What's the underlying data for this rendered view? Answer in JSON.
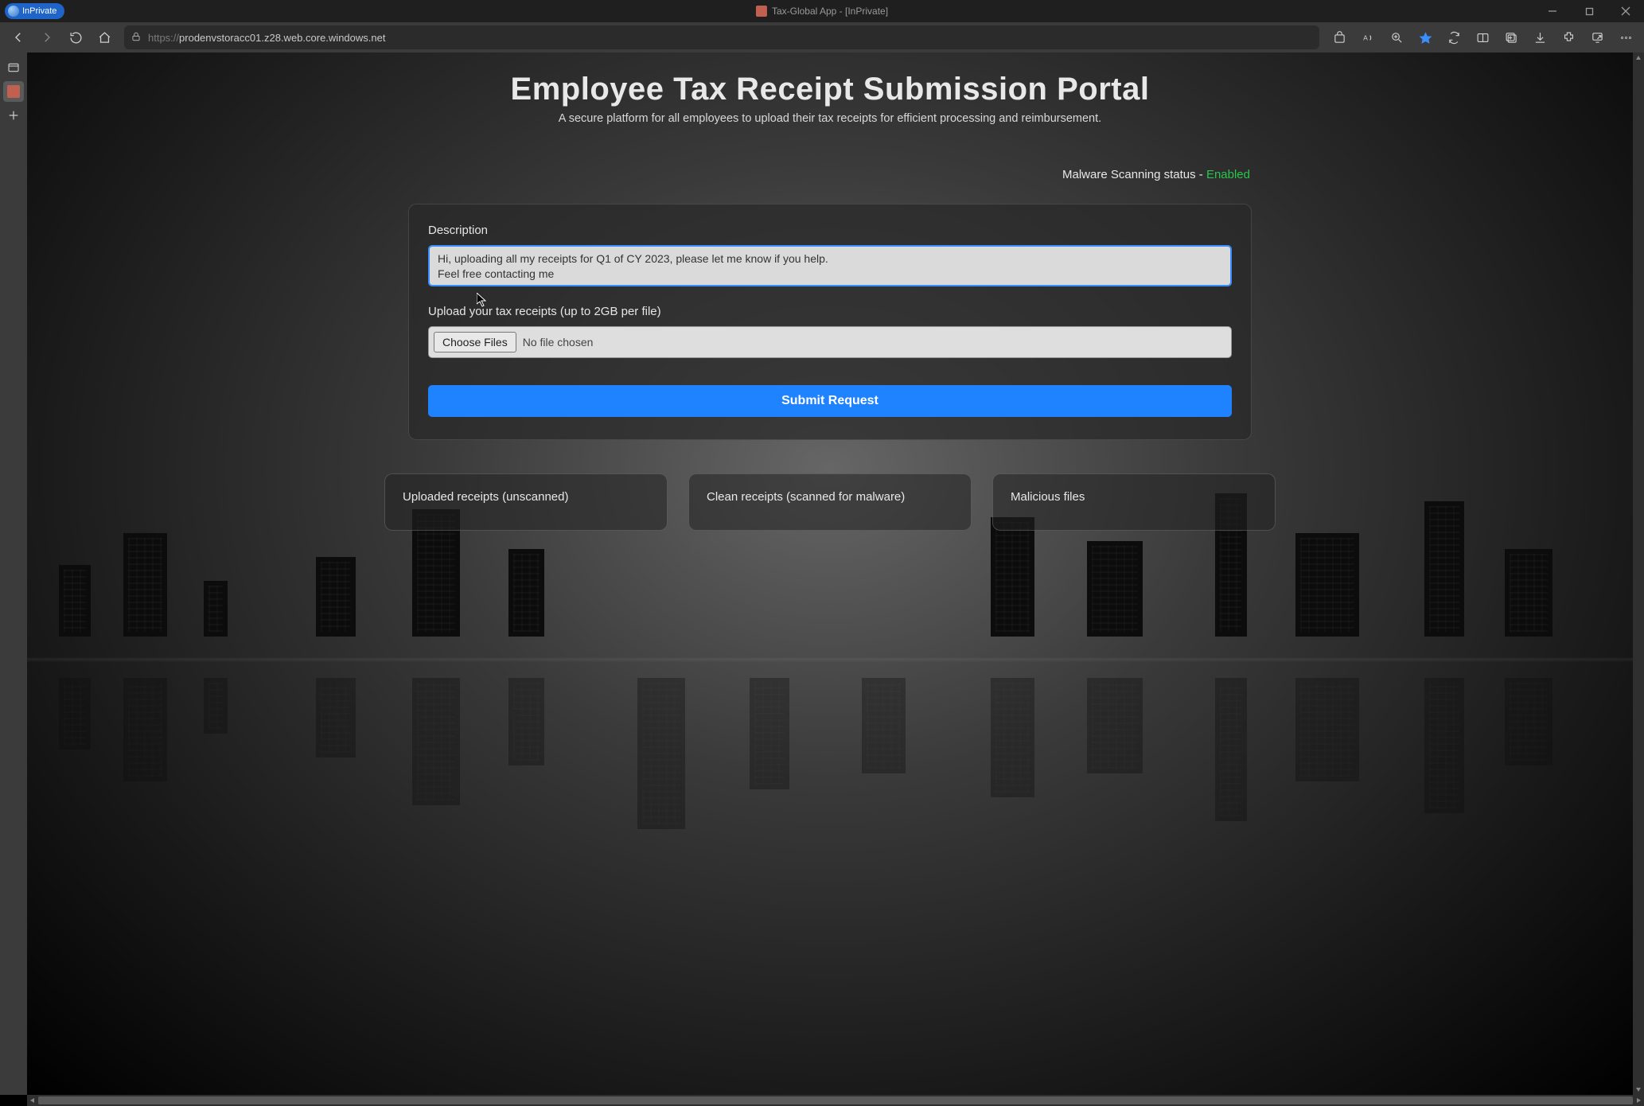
{
  "titlebar": {
    "badge": "InPrivate",
    "app_title": "Tax-Global App - [InPrivate]"
  },
  "toolbar": {
    "url_full": "https://prodenvstoracc01.z28.web.core.windows.net",
    "url_prefix": "https://",
    "url_host": "prodenvstoracc01.z28.web.core.windows.net"
  },
  "page": {
    "title": "Employee Tax Receipt Submission Portal",
    "subtitle": "A secure platform for all employees to upload their tax receipts for efficient processing and reimbursement.",
    "scan_status_label": "Malware Scanning status - ",
    "scan_status_value": "Enabled",
    "desc_label": "Description",
    "desc_value": "Hi, uploading all my receipts for Q1 of CY 2023, please let me know if you help.\nFeel free contacting me",
    "upload_label": "Upload your tax receipts (up to 2GB per file)",
    "choose_label": "Choose Files",
    "no_file": "No file chosen",
    "submit_label": "Submit Request",
    "panel1": "Uploaded receipts (unscanned)",
    "panel2": "Clean receipts (scanned for malware)",
    "panel3": "Malicious files"
  }
}
